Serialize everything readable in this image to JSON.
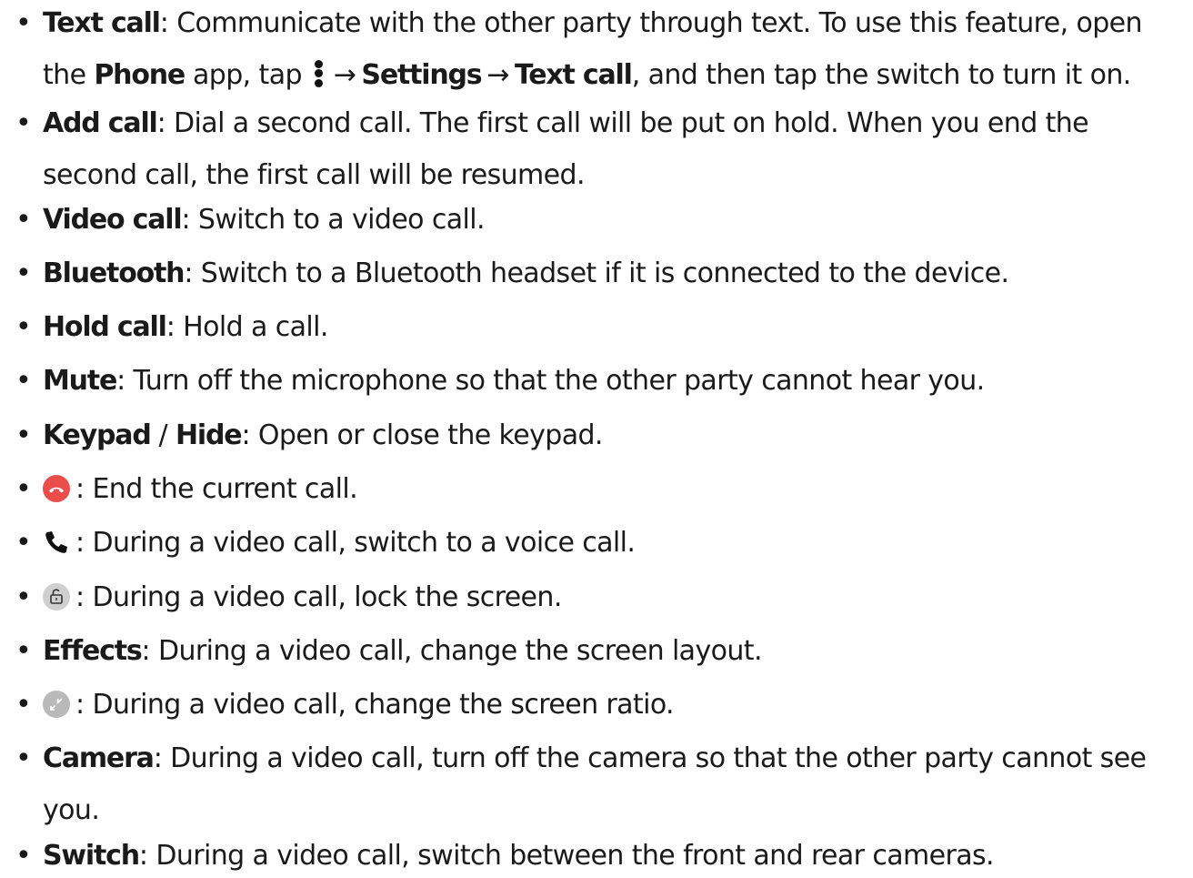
{
  "items": [
    {
      "bold": "Text call",
      "desc_a": ": Communicate with the other party through text. To use this feature, open",
      "line2_a": "the ",
      "bold2": "Phone",
      "line2_b": " app, tap ",
      "arrow1": "→",
      "bold3": "Settings",
      "arrow2": "→",
      "bold4": "Text call",
      "line2_c": ", and then tap the switch to turn it on."
    },
    {
      "bold": "Add call",
      "desc": ": Dial a second call. The first call will be put on hold. When you end the",
      "line2": "second call, the first call will be resumed."
    },
    {
      "bold": "Video call",
      "desc": ": Switch to a video call."
    },
    {
      "bold": "Bluetooth",
      "desc": ": Switch to a Bluetooth headset if it is connected to the device."
    },
    {
      "bold": "Hold call",
      "desc": ": Hold a call."
    },
    {
      "bold": "Mute",
      "desc": ": Turn off the microphone so that the other party cannot hear you."
    },
    {
      "bold": "Keypad",
      "sep": " / ",
      "bold_b": "Hide",
      "desc": ": Open or close the keypad."
    },
    {
      "icon": "end-call-icon",
      "desc": ": End the current call."
    },
    {
      "icon": "voice-call-icon",
      "desc": ": During a video call, switch to a voice call."
    },
    {
      "icon": "lock-icon",
      "desc": ": During a video call, lock the screen."
    },
    {
      "bold": "Effects",
      "desc": ": During a video call, change the screen layout."
    },
    {
      "icon": "screen-ratio-icon",
      "desc": ": During a video call, change the screen ratio."
    },
    {
      "bold": "Camera",
      "desc": ": During a video call, turn off the camera so that the other party cannot see",
      "line2": "you."
    },
    {
      "bold": "Switch",
      "desc": ": During a video call, switch between the front and rear cameras."
    }
  ],
  "bullet": "•",
  "colors": {
    "end_call": "#ea4d4a",
    "lock_bg": "#cfcfcf",
    "ratio_bg": "#b9b9b9",
    "text": "#1a1a1a"
  }
}
